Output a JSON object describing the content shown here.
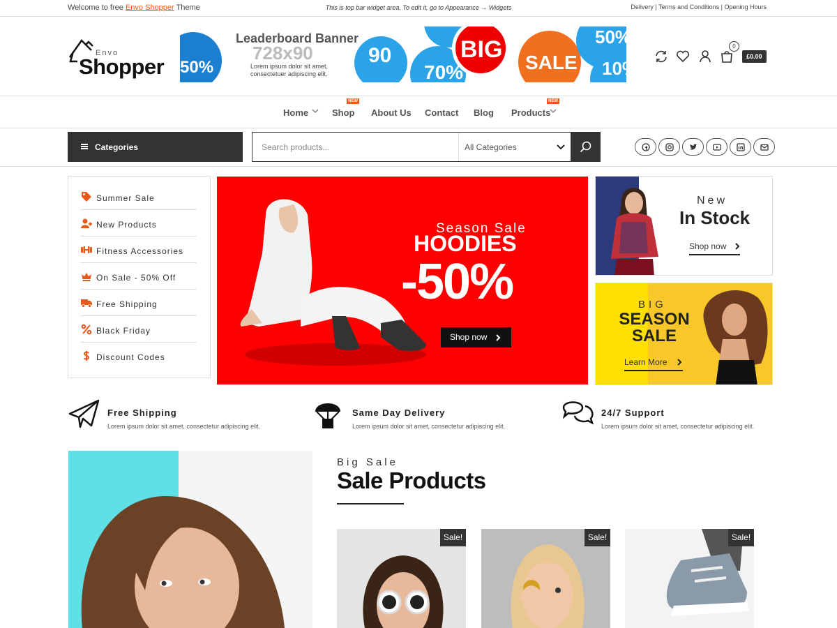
{
  "topbar": {
    "welcome_prefix": "Welcome to free",
    "theme_link": "Envo Shopper",
    "welcome_suffix": "Theme",
    "widget_text": "This is top bar widget area. To edit it, go to Appearance → Widgets",
    "right_links": "Delivery | Terms and Conditions | Opening Hours"
  },
  "logo": {
    "small": "Envo",
    "main": "Shopper"
  },
  "banner": {
    "title": "Leaderboard Banner",
    "size": "728x90",
    "desc_line1": "Lorem ipsum dolor sit amet,",
    "desc_line2": "consectetuer adipiscing elit.",
    "big_word": "BIG",
    "sale_word": "SALE",
    "n1": "50%",
    "n2": "90",
    "n3": "70%",
    "n4": "50%",
    "n5": "10%"
  },
  "header": {
    "cart_count": "0",
    "cart_total": "£0.00"
  },
  "nav": {
    "items": [
      "Home",
      "Shop",
      "About Us",
      "Contact",
      "Blog",
      "Products"
    ],
    "badge": "NEW"
  },
  "catbar": {
    "categories_label": "Categories",
    "search_placeholder": "Search products...",
    "all_categories": "All Categories"
  },
  "sidemenu": {
    "items": [
      "Summer Sale",
      "New Products",
      "Fitness Accessories",
      "On Sale - 50% Off",
      "Free Shipping",
      "Black Friday",
      "Discount Codes"
    ]
  },
  "hero": {
    "season": "Season Sale",
    "hoodies": "HOODIES",
    "off": "-50%",
    "button": "Shop now"
  },
  "promo1": {
    "line1": "New",
    "line2": "In Stock",
    "link": "Shop now"
  },
  "promo2": {
    "line1": "BIG",
    "line2": "SEASON",
    "line3": "SALE",
    "link": "Learn More"
  },
  "features": [
    {
      "title": "Free Shipping",
      "desc": "Lorem ipsum dolor sit amet, consectetur adipiscing elit."
    },
    {
      "title": "Same Day Delivery",
      "desc": "Lorem ipsum dolor sit amet, consectetur adipiscing elit."
    },
    {
      "title": "24/7 Support",
      "desc": "Lorem ipsum dolor sit amet, consectetur adipiscing elit."
    }
  ],
  "sale_section": {
    "subtitle": "Big Sale",
    "title": "Sale Products",
    "badge": "Sale!"
  },
  "colors": {
    "accent": "#e85a1a",
    "dark": "#333333",
    "hero_red": "#ff0000",
    "promo_yellow": "#ffe000"
  }
}
